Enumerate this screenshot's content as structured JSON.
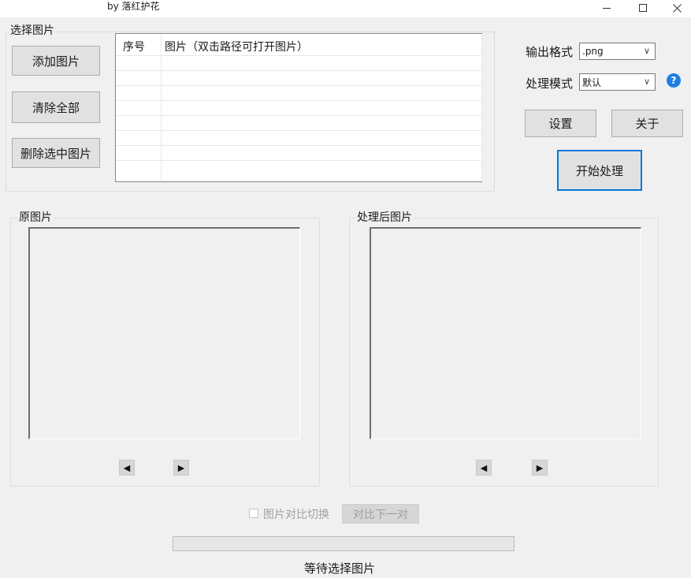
{
  "window": {
    "title": "by 落红护花",
    "minimize_glyph": "—",
    "maximize_glyph": "☐",
    "close_glyph": "✕"
  },
  "select_group": {
    "title": "选择图片",
    "add_button": "添加图片",
    "clear_button": "清除全部",
    "delete_button": "删除选中图片"
  },
  "table": {
    "columns": [
      "序号",
      "图片（双击路径可打开图片）"
    ],
    "rows": []
  },
  "settings": {
    "output_format_label": "输出格式",
    "output_format_value": ".png",
    "process_mode_label": "处理模式",
    "process_mode_value": "默认",
    "help_icon": "?",
    "settings_button": "设置",
    "about_button": "关于",
    "start_button": "开始处理"
  },
  "original_panel": {
    "title": "原图片",
    "prev_glyph": "◀",
    "next_glyph": "▶"
  },
  "processed_panel": {
    "title": "处理后图片",
    "prev_glyph": "◀",
    "next_glyph": "▶"
  },
  "compare": {
    "checkbox_label": "图片对比切换",
    "checked": false,
    "next_pair_button": "对比下一对"
  },
  "progress": {
    "value": 0
  },
  "status": {
    "text": "等待选择图片"
  },
  "colors": {
    "accent": "#0078d7",
    "help": "#1e7fe0",
    "background": "#f0f0f0"
  }
}
